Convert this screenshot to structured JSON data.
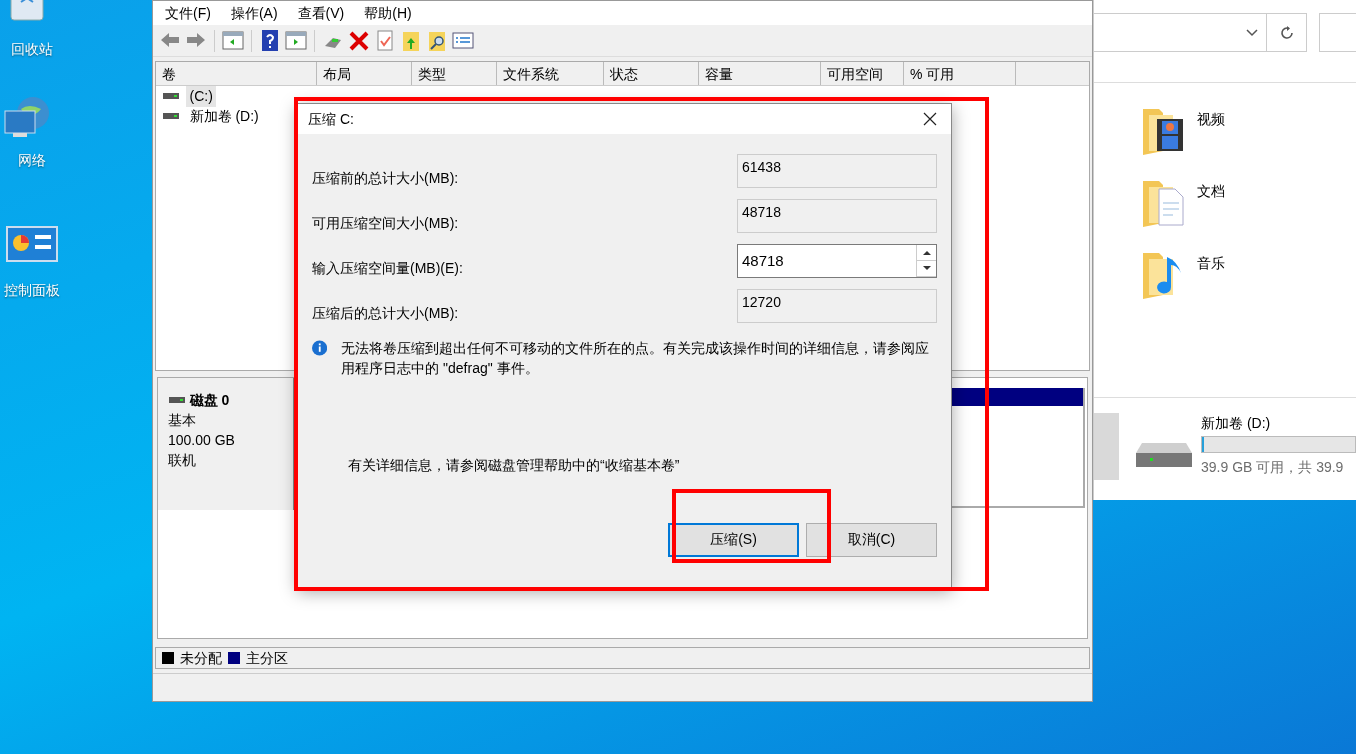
{
  "desktop_icons": [
    {
      "label": "回收站",
      "kind": "recycle"
    },
    {
      "label": "网络",
      "kind": "network"
    },
    {
      "label": "控制面板",
      "kind": "control"
    }
  ],
  "disk_management": {
    "menu": [
      "文件(F)",
      "操作(A)",
      "查看(V)",
      "帮助(H)"
    ],
    "columns": [
      "卷",
      "布局",
      "类型",
      "文件系统",
      "状态",
      "容量",
      "可用空间",
      "% 可用"
    ],
    "volumes": [
      {
        "name": "(C:)",
        "selected": true
      },
      {
        "name": "新加卷 (D:)",
        "selected": false
      }
    ],
    "disk": {
      "name": "磁盘 0",
      "type": "基本",
      "size": "100.00 GB",
      "status": "联机"
    },
    "legend": [
      {
        "label": "未分配",
        "color": "#000000"
      },
      {
        "label": "主分区",
        "color": "#000080"
      }
    ]
  },
  "dialog": {
    "title": "压缩 C:",
    "fields": [
      {
        "label": "压缩前的总计大小(MB):",
        "value": "61438",
        "kind": "readonly"
      },
      {
        "label": "可用压缩空间大小(MB):",
        "value": "48718",
        "kind": "readonly"
      },
      {
        "label": "输入压缩空间量(MB)(E):",
        "value": "48718",
        "kind": "spinner"
      },
      {
        "label": "压缩后的总计大小(MB):",
        "value": "12720",
        "kind": "readonly"
      }
    ],
    "info": "无法将卷压缩到超出任何不可移动的文件所在的点。有关完成该操作时间的详细信息，请参阅应用程序日志中的 \"defrag\" 事件。",
    "help": "有关详细信息，请参阅磁盘管理帮助中的“收缩基本卷”",
    "buttons": [
      {
        "label": "压缩(S)",
        "default": true
      },
      {
        "label": "取消(C)",
        "default": false
      }
    ]
  },
  "explorer": {
    "folders": [
      {
        "label": "视频",
        "kind": "video"
      },
      {
        "label": "文档",
        "kind": "document"
      },
      {
        "label": "音乐",
        "kind": "music"
      }
    ],
    "drive": {
      "name": "新加卷 (D:)",
      "level": 0.01,
      "detail": "39.9 GB 可用，共 39.9"
    }
  }
}
